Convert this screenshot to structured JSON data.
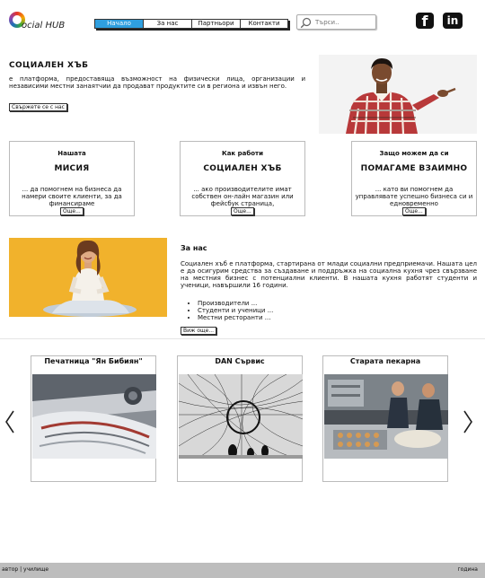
{
  "logo": {
    "label": "ocial HUB"
  },
  "nav": {
    "items": [
      {
        "label": "Начало",
        "active": true
      },
      {
        "label": "За нас"
      },
      {
        "label": "Партньори"
      },
      {
        "label": "Контакти"
      }
    ]
  },
  "search": {
    "placeholder": "Търси.."
  },
  "social": {
    "facebook": "f",
    "linkedin": "in"
  },
  "hero": {
    "title": "СОЦИАЛЕН ХЪБ",
    "text": "е платформа, предоставяща възможност на физически лица, организации и независими местни занаятчии да продават продуктите си в региона и извън него.",
    "button": "Свържете се с нас"
  },
  "features": [
    {
      "pre": "Нашата",
      "big": "МИСИЯ",
      "desc": "... да помогнем на бизнеса да намери своите клиенти, за да финансираме",
      "more": "Още..."
    },
    {
      "pre": "Как работи",
      "big": "СОЦИАЛЕН ХЪБ",
      "desc": "... ако производителите имат собствен он-лайн магазин или фейсбук страница,",
      "more": "Още..."
    },
    {
      "pre": "Защо можем да си",
      "big": "ПОМАГАМЕ ВЗАИМНО",
      "desc": "... като ви помогнем да управлявате успешно бизнеса си и едновременно",
      "more": "Още..."
    }
  ],
  "about": {
    "title": "За нас",
    "text": "Социален хъб е платформа, стартирана от млади социални предприемачи. Нашата цел е да осигурим средства за създаване и поддръжка на социална кухня чрез свързване на местния бизнес с потенциални клиенти. В нашата кухня работят студенти и ученици, навършили 16 години.",
    "list": [
      "Производители ...",
      "Студенти и ученици ...",
      "Местни ресторанти ..."
    ],
    "button": "Виж още..."
  },
  "partners": [
    {
      "title": "Печатница \"Ян Бибиян\""
    },
    {
      "title": "DAN Сървис"
    },
    {
      "title": "Старата пекарна"
    }
  ],
  "footer": {
    "left": "автор | училище",
    "right": "година"
  },
  "colors": {
    "nav_active": "#2f9fdf",
    "footer_bg": "#bdbdbd",
    "about_img_bg": "#f1b22c"
  },
  "icons": [
    "search-icon",
    "facebook-icon",
    "linkedin-icon",
    "chevron-left-icon",
    "chevron-right-icon"
  ]
}
